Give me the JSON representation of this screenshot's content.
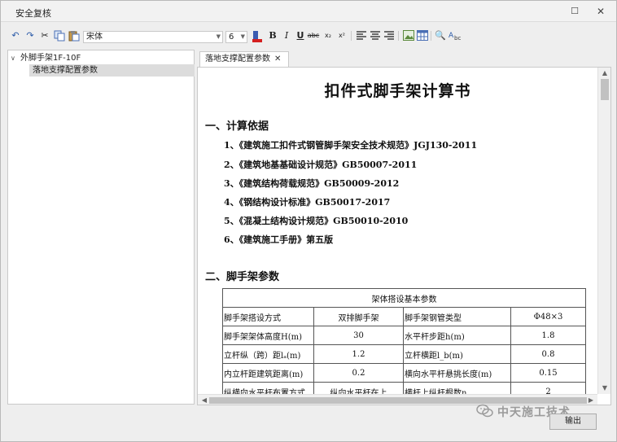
{
  "window": {
    "title": "安全复核",
    "maximize_glyph": "☐",
    "close_glyph": "✕"
  },
  "toolbar": {
    "undo_icon": "↶",
    "redo_icon": "↷",
    "cut_icon": "✂",
    "font_name": "宋体",
    "font_size": "6",
    "bold": "B",
    "italic": "I",
    "underline": "U",
    "strike": "abc",
    "subscript": "x₂",
    "superscript": "x²",
    "find_icon": "🔍"
  },
  "tree": {
    "root_label": "外脚手架1F-10F",
    "child_label": "落地支撑配置参数"
  },
  "tab": {
    "label": "落地支撑配置参数",
    "close_glyph": "✕"
  },
  "document": {
    "title": "扣件式脚手架计算书",
    "section1": "一、计算依据",
    "references": [
      "1、《建筑施工扣件式钢管脚手架安全技术规范》JGJ130-2011",
      "2、《建筑地基基础设计规范》GB50007-2011",
      "3、《建筑结构荷载规范》GB50009-2012",
      "4、《钢结构设计标准》GB50017-2017",
      "5、《混凝土结构设计规范》GB50010-2010",
      "6、《建筑施工手册》第五版"
    ],
    "section2": "二、脚手架参数",
    "table": {
      "header": "架体搭设基本参数",
      "rows": [
        [
          "脚手架搭设方式",
          "双排脚手架",
          "脚手架钢管类型",
          "Φ48×3"
        ],
        [
          "脚手架架体高度H(m)",
          "30",
          "水平杆步距h(m)",
          "1.8"
        ],
        [
          "立杆纵（跨）距lₐ(m)",
          "1.2",
          "立杆横距l_b(m)",
          "0.8"
        ],
        [
          "内立杆距建筑距离(m)",
          "0.2",
          "横向水平杆悬挑长度(m)",
          "0.15"
        ],
        [
          "纵横向水平杆布置方式",
          "纵向水平杆在上",
          "横杆上纵杆根数n",
          "2"
        ]
      ]
    }
  },
  "footer": {
    "output_label": "输出",
    "watermark": "中天施工技术"
  }
}
